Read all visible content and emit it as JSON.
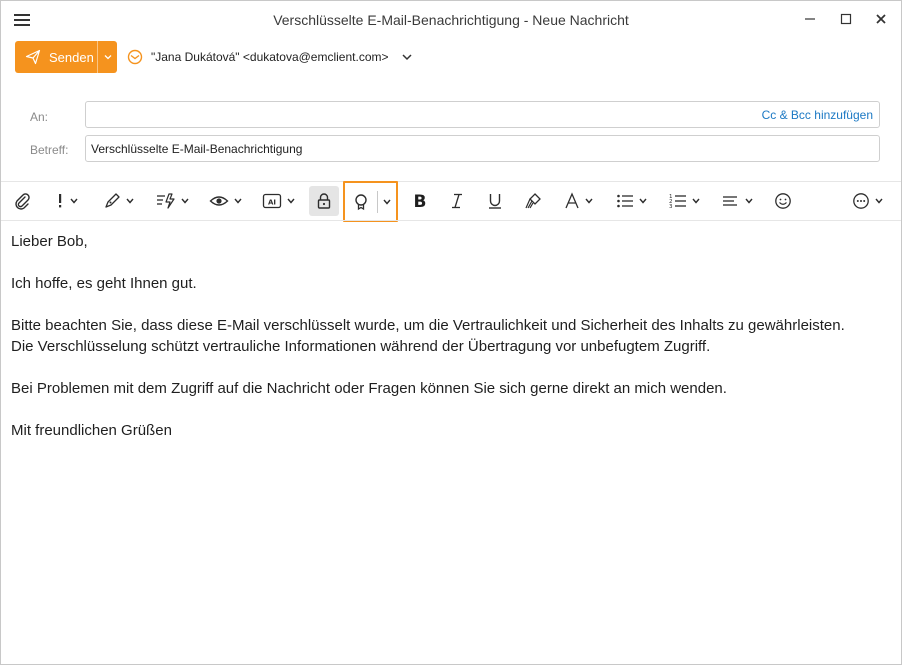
{
  "window": {
    "title": "Verschlüsselte E-Mail-Benachrichtigung - Neue Nachricht",
    "controls": [
      "minimize-icon",
      "maximize-icon",
      "close-icon"
    ]
  },
  "send": {
    "label": "Senden",
    "color": "#f5931e"
  },
  "from": {
    "value": "\"Jana Dukátová\" <dukatova@emclient.com>"
  },
  "fields": {
    "to_label": "An:",
    "to_value": "",
    "cc_bcc_link": "Cc & Bcc hinzufügen",
    "subject_label": "Betreff:",
    "subject_value": "Verschlüsselte E-Mail-Benachrichtigung"
  },
  "toolbar": {
    "items": [
      "attach-icon",
      "priority-icon",
      "sign-icon",
      "flag-icon",
      "read-receipt-icon",
      "text-template-icon",
      "encrypt-lock-icon",
      "certificate-icon",
      "bold-icon",
      "italic-icon",
      "underline-icon",
      "format-painter-icon",
      "font-color-icon",
      "bullet-list-icon",
      "numbered-list-icon",
      "align-icon",
      "emoji-icon",
      "more-icon"
    ],
    "highlight_color": "#f5931e"
  },
  "message": {
    "greeting": "Lieber Bob,",
    "line1": "Ich hoffe, es geht Ihnen gut.",
    "para1_line1": "Bitte beachten Sie, dass diese E-Mail verschlüsselt wurde, um die Vertraulichkeit und Sicherheit des Inhalts zu gewährleisten.",
    "para1_line2": "Die Verschlüsselung schützt vertrauliche Informationen während der Übertragung vor unbefugtem Zugriff.",
    "para2": "Bei Problemen mit dem Zugriff auf die Nachricht oder Fragen können Sie sich gerne direkt an mich wenden.",
    "closing": "Mit freundlichen Grüßen"
  }
}
